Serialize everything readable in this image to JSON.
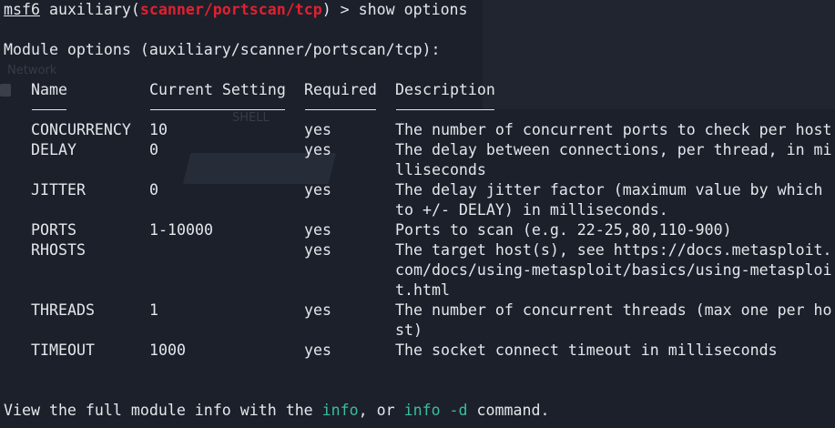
{
  "prompt": {
    "ident": "msf6",
    "pre": " auxiliary(",
    "module": "scanner/portscan/tcp",
    "post": ") > ",
    "command": "show options"
  },
  "module_header": "Module options (auxiliary/scanner/portscan/tcp):",
  "columns": {
    "name": "Name",
    "current": "Current Setting",
    "required": "Required",
    "description": "Description"
  },
  "rows": [
    {
      "name": "CONCURRENCY",
      "current": "10",
      "required": "yes",
      "desc": [
        "The number of concurrent ports to check per host"
      ]
    },
    {
      "name": "DELAY",
      "current": "0",
      "required": "yes",
      "desc": [
        "The delay between connections, per thread, in mi",
        "lliseconds"
      ]
    },
    {
      "name": "JITTER",
      "current": "0",
      "required": "yes",
      "desc": [
        "The delay jitter factor (maximum value by which",
        "to +/- DELAY) in milliseconds."
      ]
    },
    {
      "name": "PORTS",
      "current": "1-10000",
      "required": "yes",
      "desc": [
        "Ports to scan (e.g. 22-25,80,110-900)"
      ]
    },
    {
      "name": "RHOSTS",
      "current": "",
      "required": "yes",
      "desc": [
        "The target host(s), see https://docs.metasploit.",
        "com/docs/using-metasploit/basics/using-metasploi",
        "t.html"
      ]
    },
    {
      "name": "THREADS",
      "current": "1",
      "required": "yes",
      "desc": [
        "The number of concurrent threads (max one per ho",
        "st)"
      ]
    },
    {
      "name": "TIMEOUT",
      "current": "1000",
      "required": "yes",
      "desc": [
        "The socket connect timeout in milliseconds"
      ]
    }
  ],
  "footer": {
    "pre": "View the full module info with the ",
    "info": "info",
    "mid": ", or ",
    "info_d": "info -d",
    "post": " command."
  },
  "background": {
    "ghost_label_1": "Network",
    "ghost_label_2": "SHELL"
  },
  "colors": {
    "background": "#1b1f2a",
    "text": "#e3e6ea",
    "module_red": "#e2202f",
    "command_teal": "#3bbd9b"
  }
}
